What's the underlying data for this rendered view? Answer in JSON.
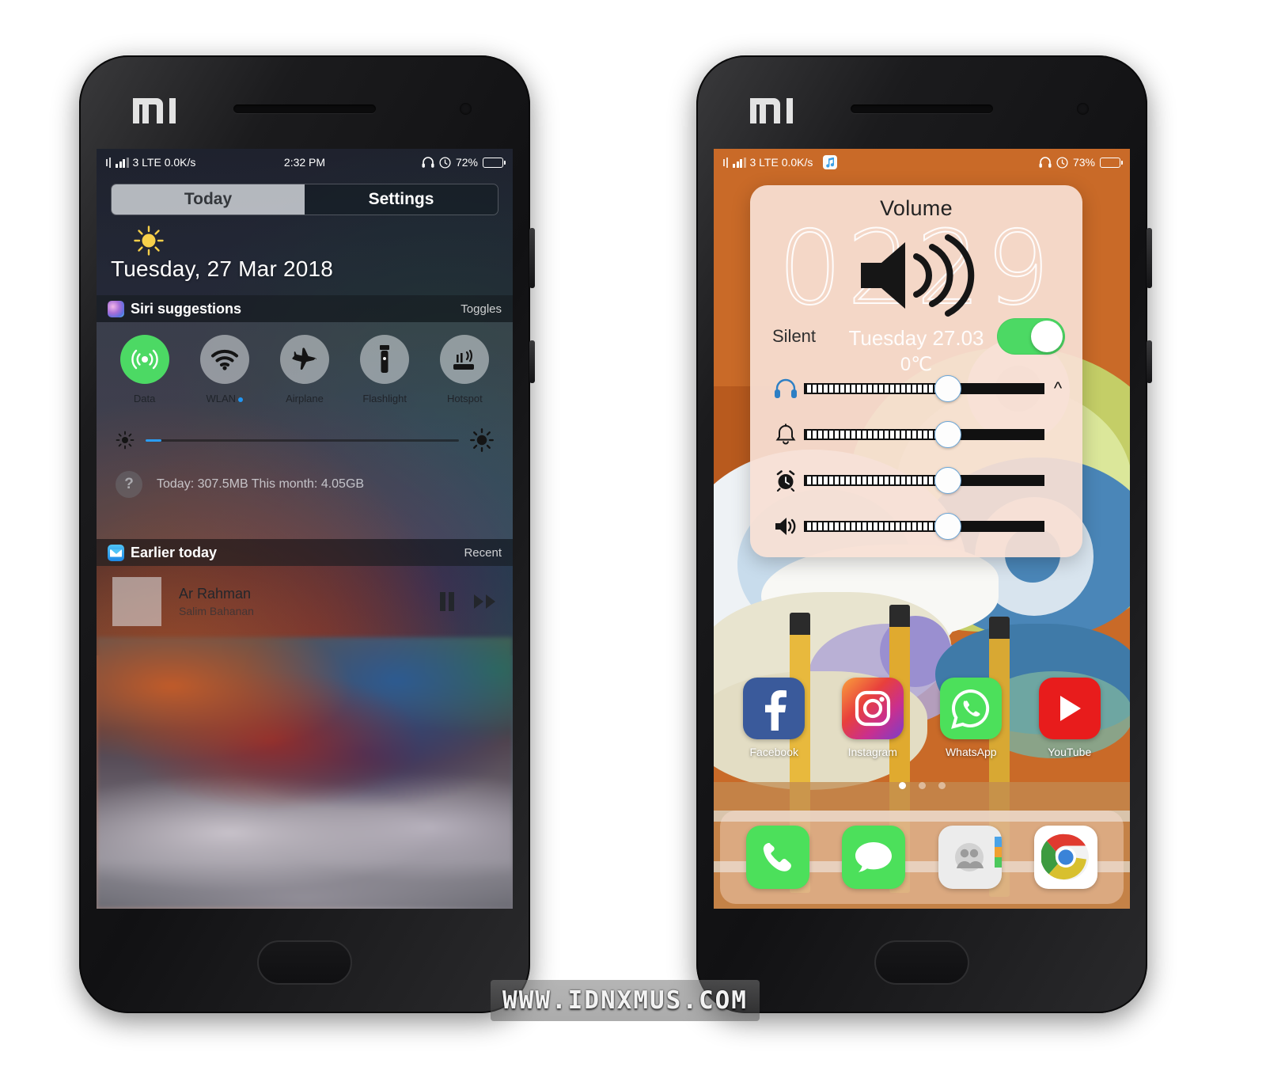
{
  "watermark": "WWW.IDNXMUS.COM",
  "brand": "MI",
  "phone_left": {
    "status_bar": {
      "sim": "3 LTE 0.0K/s",
      "time": "2:32 PM",
      "battery_percent": "72%",
      "battery_level": 72,
      "icons": [
        "vibrate-icon",
        "signal-bars-icon",
        "headphone-icon",
        "dnd-icon",
        "battery-icon"
      ]
    },
    "tabs": [
      {
        "label": "Today",
        "selected": true
      },
      {
        "label": "Settings",
        "selected": false
      }
    ],
    "date_header": {
      "text": "Tuesday, 27 Mar 2018",
      "weather_icon": "sun-icon"
    },
    "siri_section": {
      "title": "Siri suggestions",
      "right_label": "Toggles",
      "icon": "siri-icon"
    },
    "toggles": [
      {
        "label": "Data",
        "icon": "cell-data-icon",
        "on": true,
        "dot": false
      },
      {
        "label": "WLAN",
        "icon": "wifi-icon",
        "on": false,
        "dot": true
      },
      {
        "label": "Airplane",
        "icon": "airplane-icon",
        "on": false,
        "dot": false
      },
      {
        "label": "Flashlight",
        "icon": "flashlight-icon",
        "on": false,
        "dot": false
      },
      {
        "label": "Hotspot",
        "icon": "hotspot-icon",
        "on": false,
        "dot": false
      }
    ],
    "brightness": {
      "value_percent": 5,
      "left_icon": "brightness-low-icon",
      "right_icon": "brightness-high-icon"
    },
    "data_usage": {
      "help_icon": "question-mark-icon",
      "text": "Today: 307.5MB   This month: 4.05GB"
    },
    "earlier_section": {
      "title": "Earlier today",
      "right_label": "Recent",
      "icon": "mail-icon"
    },
    "now_playing": {
      "title": "Ar Rahman",
      "artist": "Salim Bahanan",
      "pause_icon": "pause-icon",
      "next_icon": "fast-forward-icon"
    }
  },
  "phone_right": {
    "status_bar": {
      "sim": "3 LTE 0.0K/s",
      "battery_percent": "73%",
      "battery_level": 73,
      "icons": [
        "vibrate-icon",
        "signal-bars-icon",
        "music-note-icon",
        "headphone-icon",
        "dnd-icon",
        "battery-icon"
      ]
    },
    "volume_panel": {
      "title": "Volume",
      "speaker_icon": "speaker-wave-icon",
      "ghost_clock": "0229",
      "ghost_date": "Tuesday 27.03",
      "ghost_temp": "0℃",
      "silent_label": "Silent",
      "silent_on": true,
      "expand_icon": "chevron-up-icon",
      "sliders": [
        {
          "name": "headphones",
          "icon": "headphones-icon",
          "value_percent": 60
        },
        {
          "name": "ringer",
          "icon": "bell-icon",
          "value_percent": 60
        },
        {
          "name": "alarm",
          "icon": "alarm-clock-icon",
          "value_percent": 60
        },
        {
          "name": "media",
          "icon": "speaker-icon",
          "value_percent": 60
        }
      ]
    },
    "apps": [
      {
        "label": "Facebook",
        "icon": "facebook-icon"
      },
      {
        "label": "Instagram",
        "icon": "instagram-icon"
      },
      {
        "label": "WhatsApp",
        "icon": "whatsapp-icon"
      },
      {
        "label": "YouTube",
        "icon": "youtube-icon"
      }
    ],
    "page_dots": {
      "count": 3,
      "active_index": 0
    },
    "dock": [
      {
        "name": "Phone",
        "icon": "phone-icon"
      },
      {
        "name": "Messages",
        "icon": "message-icon"
      },
      {
        "name": "Contacts",
        "icon": "contacts-icon"
      },
      {
        "name": "Chrome",
        "icon": "chrome-icon"
      }
    ]
  },
  "colors": {
    "accent_green": "#4cd964",
    "accent_blue": "#2a9df4",
    "wallpaper_orange": "#c96a28",
    "panel_cream": "#f7e0d4"
  }
}
